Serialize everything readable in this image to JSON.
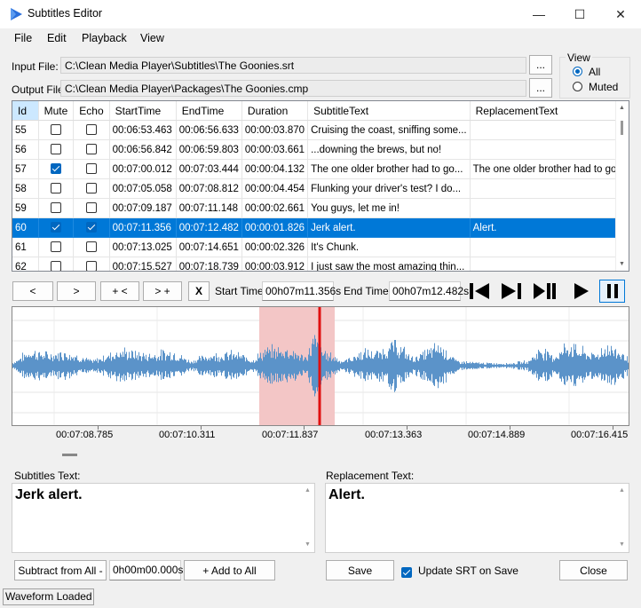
{
  "window": {
    "title": "Subtitles Editor",
    "min_glyph": "—",
    "max_glyph": "☐",
    "close_glyph": "✕"
  },
  "menu": [
    "File",
    "Edit",
    "Playback",
    "View"
  ],
  "files": {
    "input_label": "Input File:",
    "input_value": "C:\\Clean Media Player\\Subtitles\\The Goonies.srt",
    "output_label": "Output File:",
    "output_value": "C:\\Clean Media Player\\Packages\\The Goonies.cmp",
    "browse_label": "..."
  },
  "view": {
    "title": "View",
    "options": [
      "All",
      "Muted"
    ],
    "selected": "All"
  },
  "grid": {
    "columns": [
      "Id",
      "Mute",
      "Echo",
      "StartTime",
      "EndTime",
      "Duration",
      "SubtitleText",
      "ReplacementText"
    ],
    "rows": [
      {
        "id": "55",
        "mute": false,
        "echo": false,
        "start": "00:06:53.463",
        "end": "00:06:56.633",
        "dur": "00:00:03.870",
        "text": "Cruising the coast, sniffing some...",
        "repl": ""
      },
      {
        "id": "56",
        "mute": false,
        "echo": false,
        "start": "00:06:56.842",
        "end": "00:06:59.803",
        "dur": "00:00:03.661",
        "text": "...downing the brews, but no!",
        "repl": ""
      },
      {
        "id": "57",
        "mute": true,
        "echo": false,
        "start": "00:07:00.012",
        "end": "00:07:03.444",
        "dur": "00:00:04.132",
        "text": "The one older brother had to go...",
        "repl": "The one older brother had to go..."
      },
      {
        "id": "58",
        "mute": false,
        "echo": false,
        "start": "00:07:05.058",
        "end": "00:07:08.812",
        "dur": "00:00:04.454",
        "text": "Flunking your driver's test? I do...",
        "repl": ""
      },
      {
        "id": "59",
        "mute": false,
        "echo": false,
        "start": "00:07:09.187",
        "end": "00:07:11.148",
        "dur": "00:00:02.661",
        "text": "You guys, let me in!",
        "repl": ""
      },
      {
        "id": "60",
        "mute": true,
        "echo": true,
        "start": "00:07:11.356",
        "end": "00:07:12.482",
        "dur": "00:00:01.826",
        "text": "Jerk alert.",
        "repl": "Alert.",
        "selected": true
      },
      {
        "id": "61",
        "mute": false,
        "echo": false,
        "start": "00:07:13.025",
        "end": "00:07:14.651",
        "dur": "00:00:02.326",
        "text": "It's Chunk.",
        "repl": ""
      },
      {
        "id": "62",
        "mute": false,
        "echo": false,
        "start": "00:07:15.527",
        "end": "00:07:18.739",
        "dur": "00:00:03.912",
        "text": "I just saw the most amazing thin...",
        "repl": ""
      }
    ]
  },
  "transport": {
    "prev_label": "<",
    "next_label": ">",
    "add_prev_label": "+ <",
    "add_next_label": "> +",
    "clear_label": "X",
    "start_label": "Start Time:",
    "start_value": "00h07m11.356s",
    "end_label": "End Time:",
    "end_value": "00h07m12.482s"
  },
  "waveform": {
    "ticks": [
      "00:07:08.785",
      "00:07:10.311",
      "00:07:11.837",
      "00:07:13.363",
      "00:07:14.889",
      "00:07:16.415"
    ],
    "wave_color": "#5b93c9",
    "selection_color": "#f3c6c6",
    "cursor_color": "#e01010"
  },
  "editor": {
    "subtitles_label": "Subtitles Text:",
    "subtitles_value": "Jerk alert.",
    "replacement_label": "Replacement Text:",
    "replacement_value": "Alert."
  },
  "bottom": {
    "subtract_label": "Subtract from All -",
    "offset_value": "0h00m00.000s",
    "add_label": "+ Add to All",
    "save_label": "Save",
    "update_label": "Update SRT on Save",
    "update_checked": true,
    "close_label": "Close"
  },
  "status": {
    "text": "Waveform Loaded"
  },
  "colors": {
    "accent": "#0078d7",
    "selection_row": "#0078d7"
  }
}
